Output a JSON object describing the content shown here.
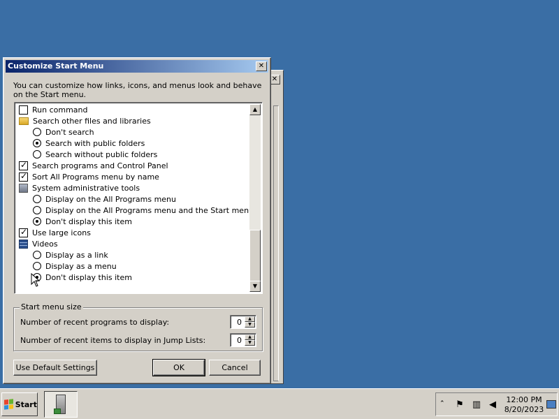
{
  "dialog": {
    "title": "Customize Start Menu",
    "close_label": "✕",
    "description": "You can customize how links, icons, and menus look and behave on the Start menu.",
    "list_items": [
      {
        "kind": "checkbox",
        "label": "Run command",
        "checked": false,
        "indent": 0
      },
      {
        "kind": "group",
        "label": "Search other files and libraries",
        "icon": "folder-icon",
        "indent": 0
      },
      {
        "kind": "radio",
        "label": "Don't search",
        "checked": false,
        "indent": 1
      },
      {
        "kind": "radio",
        "label": "Search with public folders",
        "checked": true,
        "indent": 1
      },
      {
        "kind": "radio",
        "label": "Search without public folders",
        "checked": false,
        "indent": 1
      },
      {
        "kind": "checkbox",
        "label": "Search programs and Control Panel",
        "checked": true,
        "indent": 0
      },
      {
        "kind": "checkbox",
        "label": "Sort All Programs menu by name",
        "checked": true,
        "indent": 0
      },
      {
        "kind": "group",
        "label": "System administrative tools",
        "icon": "tools-icon",
        "indent": 0
      },
      {
        "kind": "radio",
        "label": "Display on the All Programs menu",
        "checked": false,
        "indent": 1
      },
      {
        "kind": "radio",
        "label": "Display on the All Programs menu and the Start menu",
        "checked": false,
        "indent": 1
      },
      {
        "kind": "radio",
        "label": "Don't display this item",
        "checked": true,
        "indent": 1
      },
      {
        "kind": "checkbox",
        "label": "Use large icons",
        "checked": true,
        "indent": 0
      },
      {
        "kind": "group",
        "label": "Videos",
        "icon": "video-icon",
        "indent": 0
      },
      {
        "kind": "radio",
        "label": "Display as a link",
        "checked": false,
        "indent": 1
      },
      {
        "kind": "radio",
        "label": "Display as a menu",
        "checked": false,
        "indent": 1
      },
      {
        "kind": "radio",
        "label": "Don't display this item",
        "checked": true,
        "indent": 1
      }
    ],
    "size_group": {
      "title": "Start menu size",
      "recent_programs_label": "Number of recent programs to display:",
      "recent_programs_value": "0",
      "recent_items_label": "Number of recent items to display in Jump Lists:",
      "recent_items_value": "0"
    },
    "buttons": {
      "default_settings": "Use Default Settings",
      "ok": "OK",
      "cancel": "Cancel"
    }
  },
  "taskbar": {
    "start_label": "Start",
    "clock_time": "12:00 PM",
    "clock_date": "8/20/2023",
    "tray_chevron": "ˆ"
  }
}
